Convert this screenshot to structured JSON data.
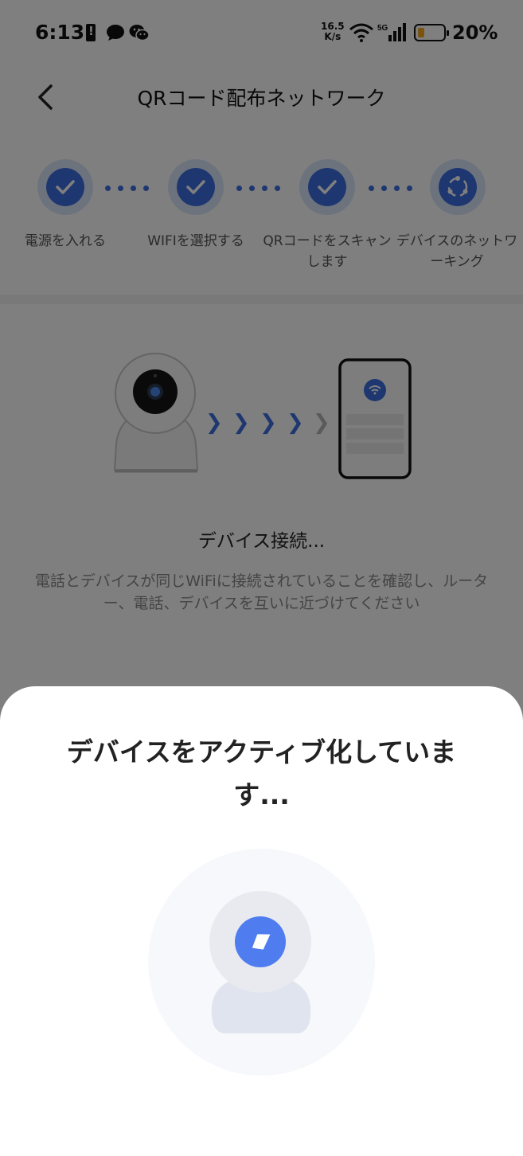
{
  "status_bar": {
    "time": "6:13",
    "net_speed_value": "16.5",
    "net_speed_unit": "K/s",
    "battery_percent": "20%"
  },
  "header": {
    "title": "QRコード配布ネットワーク"
  },
  "steps": [
    {
      "label": "電源を入れる",
      "state": "done",
      "icon": "check-icon"
    },
    {
      "label": "WIFIを選択する",
      "state": "done",
      "icon": "check-icon"
    },
    {
      "label": "QRコードをスキャンします",
      "state": "done",
      "icon": "check-icon"
    },
    {
      "label": "デバイスのネットワーキング",
      "state": "active",
      "icon": "network-icon"
    }
  ],
  "connection": {
    "title": "デバイス接続...",
    "description": "電話とデバイスが同じWiFiに接続されていることを確認し、ルーター、電話、デバイスを互いに近づけてください"
  },
  "sheet": {
    "title": "デバイスをアクティブ化しています..."
  },
  "colors": {
    "accent": "#3d6ee0",
    "accent_light": "#dbe6fb",
    "battery_low": "#f5a623",
    "overlay": "rgba(0,0,0,0.5)"
  }
}
